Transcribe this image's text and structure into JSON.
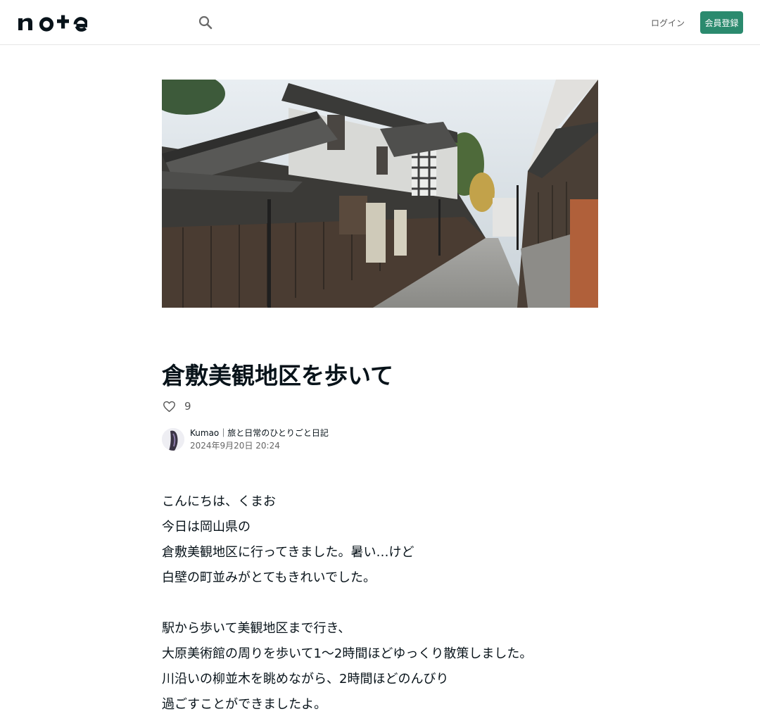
{
  "header": {
    "logo_text": "note",
    "search_icon": "search-icon",
    "login_label": "ログイン",
    "signup_label": "会員登録",
    "accent_color": "#2b8a6e"
  },
  "article": {
    "title": "倉敷美観地区を歩いて",
    "like_icon": "heart-outline-icon",
    "likes": "9",
    "author_name": "Kumao｜旅と日常のひとりごと日記",
    "date": "2024年9月20日 20:24",
    "body_lines": [
      "こんにちは、くまお",
      "今日は岡山県の",
      "倉敷美観地区に行ってきました。暑い…けど",
      "白壁の町並みがとてもきれいでした。",
      "",
      "駅から歩いて美観地区まで行き、",
      "大原美術館の周りを歩いて1〜2時間ほどゆっくり散策しました。",
      "川沿いの柳並木を眺めながら、2時間ほどのんびり",
      "過ごすことができましたよ。"
    ]
  }
}
